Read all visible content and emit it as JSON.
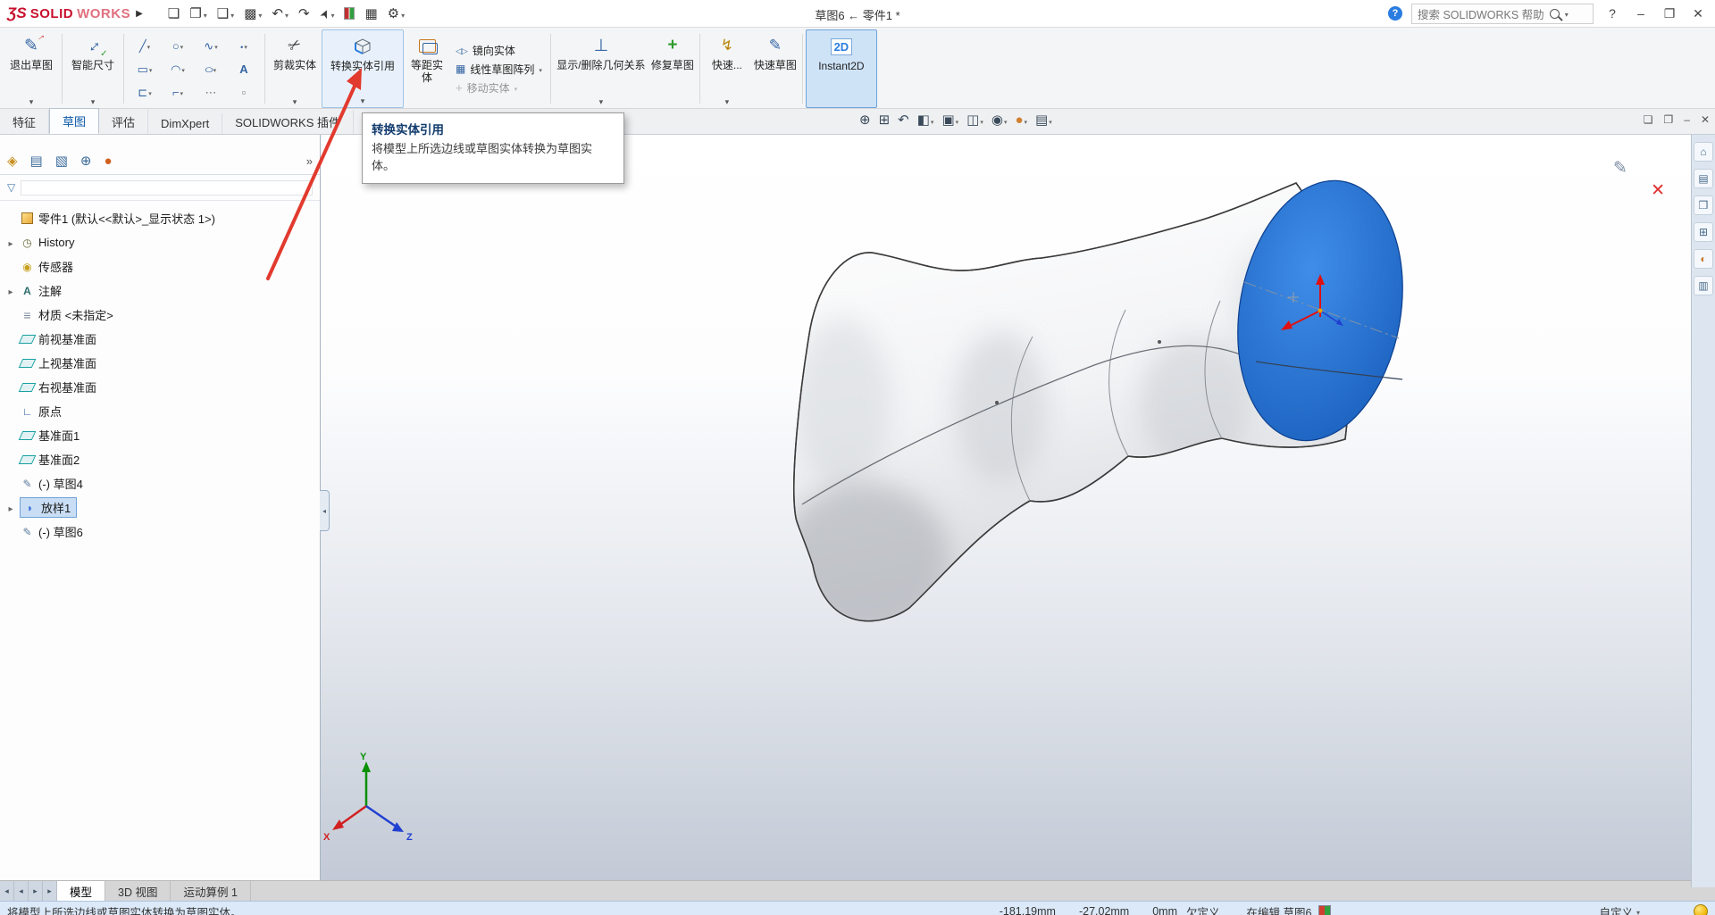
{
  "colors": {
    "brand_red": "#c8102e",
    "selection_blue": "#1a6fd4",
    "annotation_arrow_red": "#e23a2e",
    "active_tool_highlight": "#cfe3f7",
    "statusbar_bg": "#dce9f9"
  },
  "titlebar": {
    "logo_mark": "ƷS",
    "logo_bold": "SOLID",
    "logo_light": "WORKS",
    "doc_title": "草图6 ← 零件1 *",
    "search_text": "搜索 SOLIDWORKS 帮助",
    "tool_icons": [
      "new-document",
      "open",
      "save",
      "print",
      "undo",
      "redo",
      "select-arrow",
      "options-stats",
      "view-grid",
      "settings-gear"
    ]
  },
  "ribbon_tabs": [
    {
      "label": "特征"
    },
    {
      "label": "草图"
    },
    {
      "label": "评估"
    },
    {
      "label": "DimXpert"
    },
    {
      "label": "SOLIDWORKS 插件"
    }
  ],
  "ribbon": {
    "exit_sketch": "退出草图",
    "smart_dimension": "智能尺寸",
    "trim_entities": "剪裁实体",
    "convert_entities": "转换实体引用",
    "offset_entities": "等距实体",
    "mirror_entities": "镜向实体",
    "linear_pattern": "线性草图阵列",
    "move_entities": "移动实体",
    "display_delete_relations": "显示/删除几何关系",
    "repair_sketch": "修复草图",
    "quick_snaps": "快速...",
    "rapid_sketch": "快速草图",
    "instant2d": "Instant2D",
    "sketch_tools": [
      "line",
      "circle",
      "spline",
      "point",
      "rectangle",
      "arc",
      "ellipse",
      "text",
      "slot",
      "fillet",
      "construction-dots",
      "small-square"
    ]
  },
  "tooltip": {
    "title": "转换实体引用",
    "body": "将模型上所选边线或草图实体转换为草图实体。"
  },
  "sidebar": {
    "panel_tabs": [
      "featuremanager",
      "propertymanager",
      "configurationmanager",
      "dimxpertmanager",
      "displaymanager"
    ],
    "root": "零件1 (默认<<默认>_显示状态 1>)",
    "items": [
      {
        "label": "History"
      },
      {
        "label": "传感器"
      },
      {
        "label": "注解"
      },
      {
        "label": "材质 <未指定>"
      },
      {
        "label": "前视基准面"
      },
      {
        "label": "上视基准面"
      },
      {
        "label": "右视基准面"
      },
      {
        "label": "原点"
      },
      {
        "label": "基准面1"
      },
      {
        "label": "基准面2"
      },
      {
        "label": "(-) 草图4"
      },
      {
        "label": "放样1"
      },
      {
        "label": "(-) 草图6"
      }
    ]
  },
  "headsup_icons": [
    "zoom-to-fit",
    "zoom-to-area",
    "previous-view",
    "section-view",
    "view-orientation",
    "display-style",
    "hide-show-items",
    "edit-appearance",
    "view-settings"
  ],
  "taskpane_icons": [
    "home",
    "design-library",
    "file-explorer",
    "view-palette",
    "appearances",
    "custom-properties"
  ],
  "bottom_tabs": [
    {
      "label": "模型"
    },
    {
      "label": "3D 视图"
    },
    {
      "label": "运动算例 1"
    }
  ],
  "statusbar": {
    "message": "将模型上所选边线或草图实体转换为草图实体。",
    "x": "-181.19mm",
    "y": "-27.02mm",
    "z": "0mm",
    "state": "欠定义",
    "editing": "在编辑 草图6",
    "custom": "自定义"
  }
}
